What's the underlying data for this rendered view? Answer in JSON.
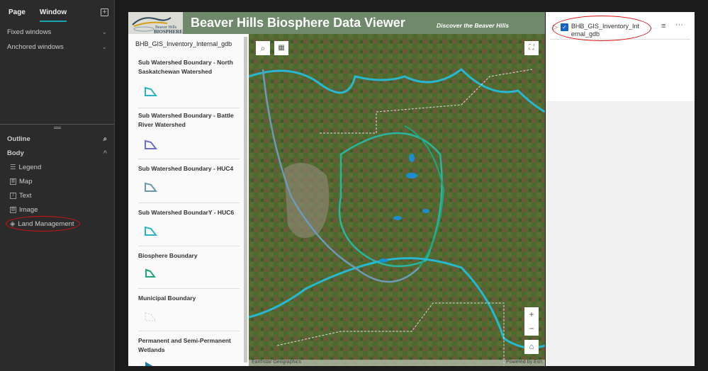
{
  "sidebar": {
    "tabs": [
      "Page",
      "Window"
    ],
    "active_tab": "Window",
    "sections": [
      "Fixed windows",
      "Anchored windows"
    ],
    "outline_label": "Outline",
    "body_label": "Body",
    "items": [
      {
        "label": "Legend",
        "icon": "list-icon"
      },
      {
        "label": "Map",
        "icon": "map-icon"
      },
      {
        "label": "Text",
        "icon": "text-icon"
      },
      {
        "label": "Image",
        "icon": "image-icon"
      },
      {
        "label": "Land Management",
        "icon": "layers-icon"
      }
    ]
  },
  "header": {
    "logo_text": "Beaver Hills BIOSPHERE",
    "title": "Beaver Hills Biosphere Data Viewer",
    "tagline": "Discover the Beaver Hills"
  },
  "legend": {
    "title": "BHB_GIS_Inventory_Internal_gdb",
    "items": [
      {
        "label": "Sub Watershed Boundary - North Saskatchewan Watershed",
        "color": "#2bb5c0"
      },
      {
        "label": "Sub Watershed Boundary - Battle River Watershed",
        "color": "#6a6fc9"
      },
      {
        "label": "Sub Watershed Boundary - HUC4",
        "color": "#6a98a8"
      },
      {
        "label": "Sub Watershed BoundarY - HUC6",
        "color": "#2bb5c0"
      },
      {
        "label": "Biosphere Boundary",
        "color": "#1fa67f"
      },
      {
        "label": "Municipal Boundary",
        "color": "#cccccc"
      },
      {
        "label": "Permanent and Semi-Permanent Wetlands",
        "color": "#1a7fa8"
      }
    ]
  },
  "map": {
    "attribution": "Earthstar Geographics",
    "powered_by": "Powered by Esri"
  },
  "layer_list": {
    "layer_name": "BHB_GIS_Inventory_Internal_gdb",
    "checked": true
  }
}
